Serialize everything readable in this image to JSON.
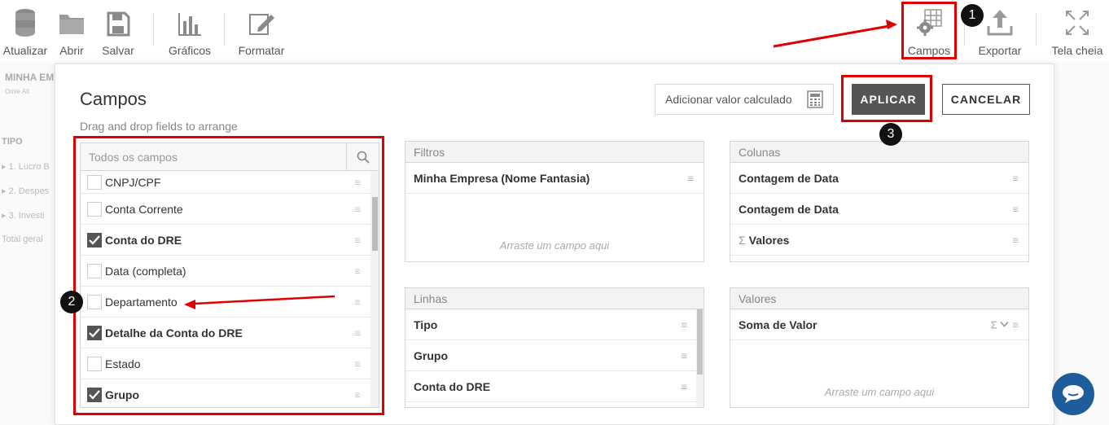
{
  "toolbar": {
    "atualizar": "Atualizar",
    "abrir": "Abrir",
    "salvar": "Salvar",
    "graficos": "Gráficos",
    "formatar": "Formatar",
    "campos": "Campos",
    "exportar": "Exportar",
    "tela_cheia": "Tela cheia"
  },
  "background": {
    "report_title": "MINHA EM",
    "report_sub": "Omie Alt",
    "col_header": "TIPO",
    "rows": [
      "1. Lucro B",
      "2. Despes",
      "3. Investi"
    ],
    "total": "Total geral"
  },
  "modal": {
    "title": "Campos",
    "subtitle": "Drag and drop fields to arrange",
    "calc_button": "Adicionar valor calculado",
    "apply_button": "APLICAR",
    "cancel_button": "CANCELAR"
  },
  "all_fields": {
    "title": "Todos os campos",
    "items": [
      {
        "label": "CNPJ/CPF",
        "checked": false
      },
      {
        "label": "Conta Corrente",
        "checked": false
      },
      {
        "label": "Conta do DRE",
        "checked": true
      },
      {
        "label": "Data (completa)",
        "checked": false
      },
      {
        "label": "Departamento",
        "checked": false
      },
      {
        "label": "Detalhe da Conta do DRE",
        "checked": true
      },
      {
        "label": "Estado",
        "checked": false
      },
      {
        "label": "Grupo",
        "checked": true
      }
    ]
  },
  "zones": {
    "filtros": {
      "title": "Filtros",
      "items": [
        "Minha Empresa (Nome Fantasia)"
      ],
      "hint": "Arraste um campo aqui"
    },
    "colunas": {
      "title": "Colunas",
      "items": [
        "Contagem de Data",
        "Contagem de Data",
        "Valores"
      ]
    },
    "linhas": {
      "title": "Linhas",
      "items": [
        "Tipo",
        "Grupo",
        "Conta do DRE"
      ]
    },
    "valores": {
      "title": "Valores",
      "items": [
        "Soma de Valor"
      ],
      "hint": "Arraste um campo aqui"
    }
  },
  "annotations": {
    "badge_1": "1",
    "badge_2": "2",
    "badge_3": "3",
    "color": "#e10000"
  },
  "colors": {
    "apply_bg": "#555555",
    "chat_bg": "#1d5d9b"
  }
}
